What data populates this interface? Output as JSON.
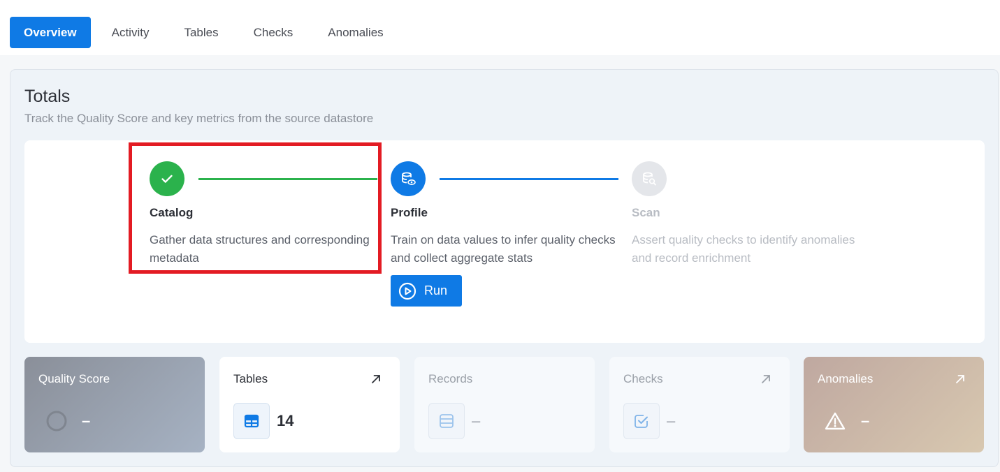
{
  "tabs": [
    {
      "label": "Overview",
      "active": true
    },
    {
      "label": "Activity"
    },
    {
      "label": "Tables"
    },
    {
      "label": "Checks"
    },
    {
      "label": "Anomalies"
    }
  ],
  "totals": {
    "title": "Totals",
    "subtitle": "Track the Quality Score and key metrics from the source datastore"
  },
  "steps": [
    {
      "title": "Catalog",
      "description": "Gather data structures and corresponding metadata",
      "status": "complete",
      "icon": "check-icon",
      "color": "#2bb24c"
    },
    {
      "title": "Profile",
      "description": "Train on data values to infer quality checks and collect aggregate stats",
      "status": "active",
      "icon": "database-eye-icon",
      "color": "#0f7ae5"
    },
    {
      "title": "Scan",
      "description": "Assert quality checks to identify anomalies and record enrichment",
      "status": "disabled",
      "icon": "database-search-icon",
      "color": "#e4e6ea"
    }
  ],
  "run_button": {
    "label": "Run",
    "icon": "play-circle-icon"
  },
  "metrics": [
    {
      "label": "Quality Score",
      "value": "–",
      "icon": "circle-gauge-icon"
    },
    {
      "label": "Tables",
      "value": "14",
      "icon": "table-icon"
    },
    {
      "label": "Records",
      "value": "–",
      "icon": "records-icon"
    },
    {
      "label": "Checks",
      "value": "–",
      "icon": "checkbox-icon"
    },
    {
      "label": "Anomalies",
      "value": "–",
      "icon": "warning-icon"
    }
  ],
  "colors": {
    "accent": "#0f7ae5",
    "success": "#2bb24c",
    "highlight": "#e31b23"
  }
}
